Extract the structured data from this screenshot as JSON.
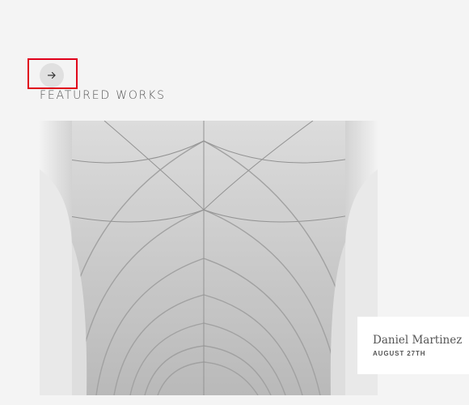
{
  "section": {
    "title": "FEATURED WORKS"
  },
  "navigation": {
    "next_icon": "arrow-right-icon"
  },
  "featured_work": {
    "image_subject": "white gothic vaulted ceiling",
    "author": "Daniel Martinez",
    "date": "AUGUST 27TH"
  },
  "colors": {
    "background": "#f4f4f4",
    "button": "#e0e0e0",
    "highlight": "#e0001a",
    "text": "#555555",
    "card": "#ffffff"
  }
}
